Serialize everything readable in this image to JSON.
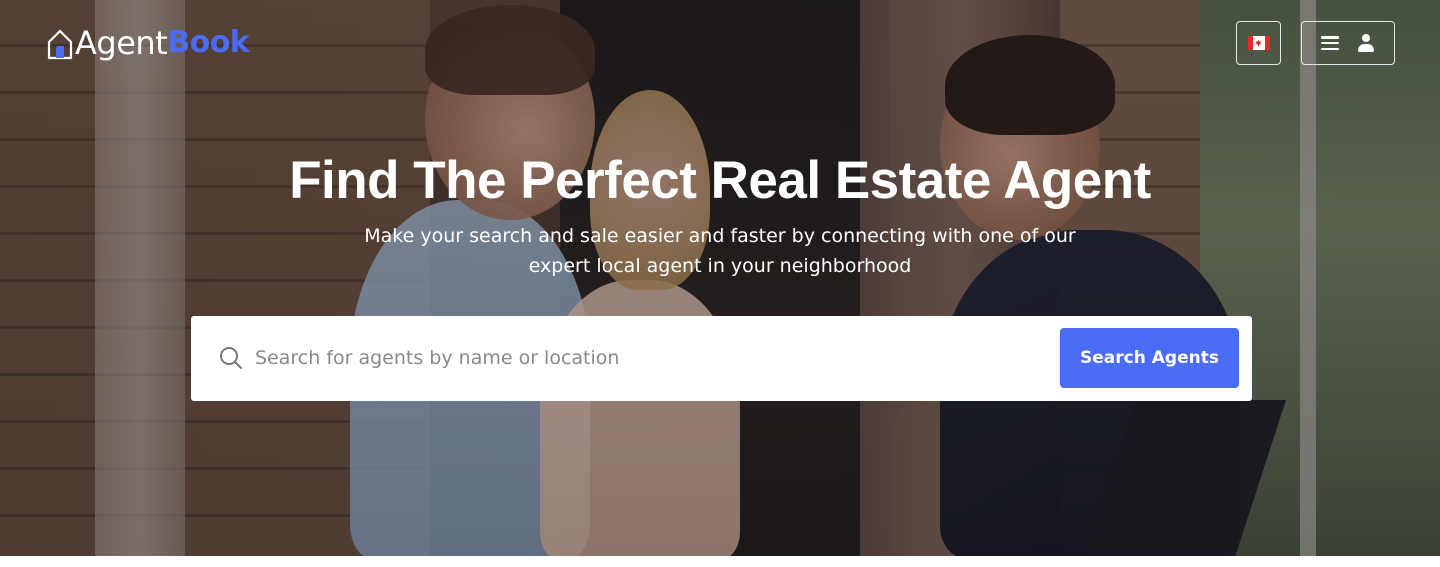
{
  "header": {
    "logo": {
      "part1": "Agent",
      "part2": "Book"
    },
    "language_button": {
      "icon": "canada-flag-icon"
    },
    "menu_button": {
      "icons": [
        "hamburger-icon",
        "user-icon"
      ]
    }
  },
  "hero": {
    "headline": "Find The Perfect Real Estate Agent",
    "subline_1": "Make your search and sale easier and faster by connecting with one of our",
    "subline_2": "expert local agent in your neighborhood"
  },
  "search": {
    "placeholder": "Search for agents by name or location",
    "value": "",
    "button_label": "Search Agents",
    "icon": "search-icon"
  },
  "colors": {
    "brand": "#4b6cf2",
    "button": "#4a6cf7",
    "text_on_hero": "#ffffff"
  }
}
